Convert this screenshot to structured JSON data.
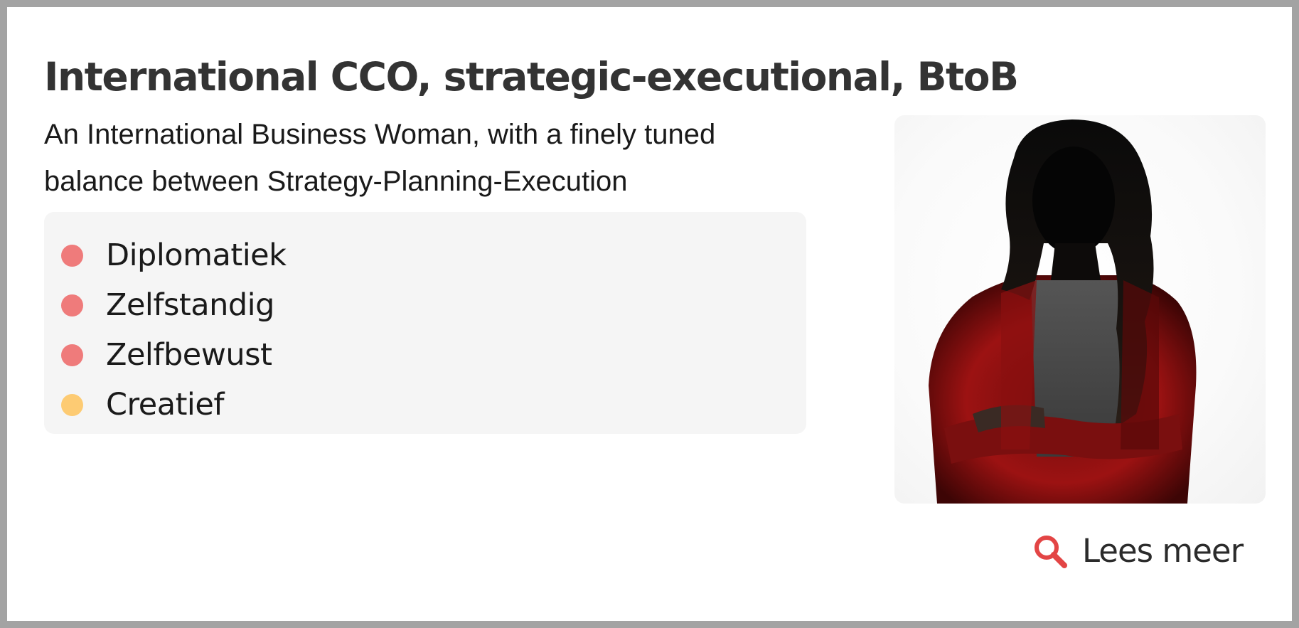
{
  "card": {
    "title": "International CCO, strategic-executional, BtoB",
    "subtitle": "An International Business Woman, with a finely tuned balance between Strategy-Planning-Execution",
    "traits": [
      {
        "label": "Diplomatiek",
        "color": "#ef7b7b"
      },
      {
        "label": "Zelfstandig",
        "color": "#ef7b7b"
      },
      {
        "label": "Zelfbewust",
        "color": "#ef7b7b"
      },
      {
        "label": "Creatief",
        "color": "#fdcb73"
      }
    ],
    "read_more": {
      "label": "Lees meer",
      "icon": "search-icon",
      "icon_color": "#e34545"
    }
  },
  "colors": {
    "border": "#a3a3a3",
    "text": "#333333",
    "trait_panel": "#f5f5f5"
  }
}
